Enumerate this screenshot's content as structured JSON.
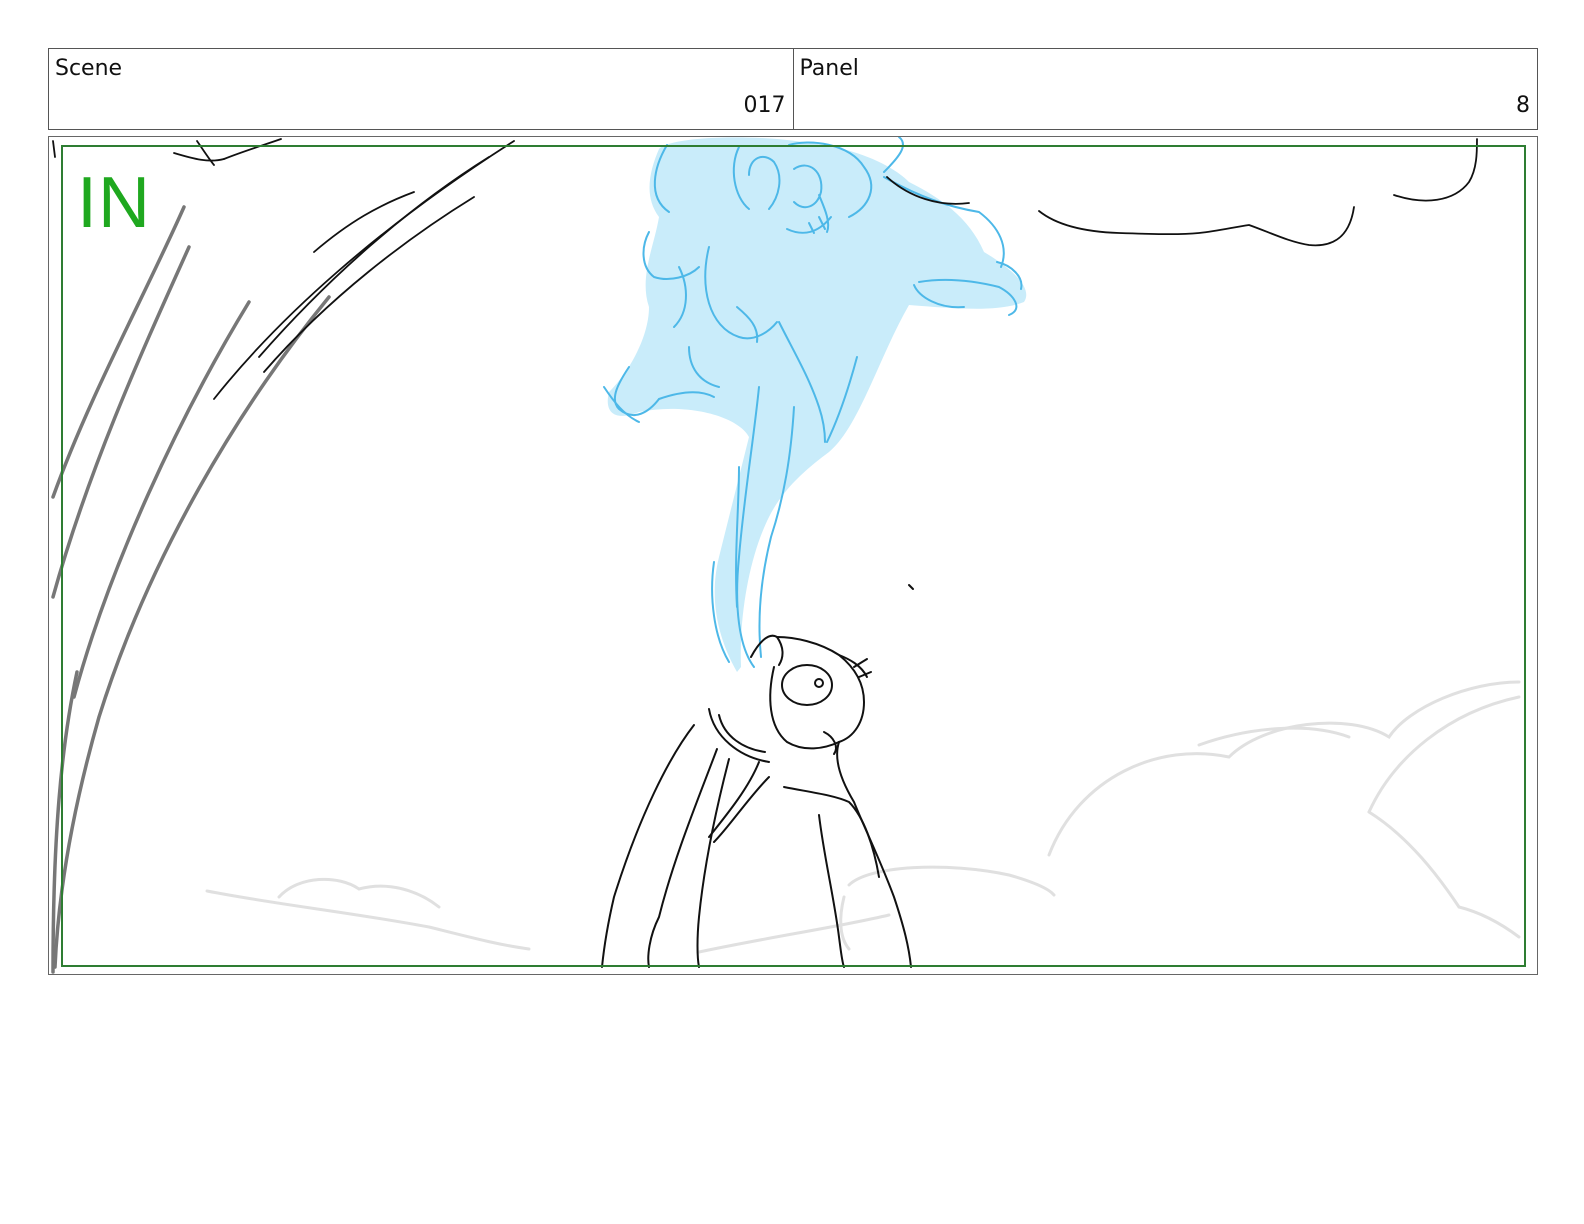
{
  "header": {
    "scene": {
      "label": "Scene",
      "value": "017"
    },
    "panel": {
      "label": "Panel",
      "value": "8"
    }
  },
  "panel_frame": {
    "transition_label": "IN",
    "colors": {
      "safe_frame": "#2e7d32",
      "transition_label": "#1fa81f",
      "genie_fill": "#c9ecfa",
      "genie_line": "#4db8e8",
      "sketch_line": "#111111",
      "tree_line": "#777777",
      "cloud_line": "#e0e0e0"
    }
  }
}
